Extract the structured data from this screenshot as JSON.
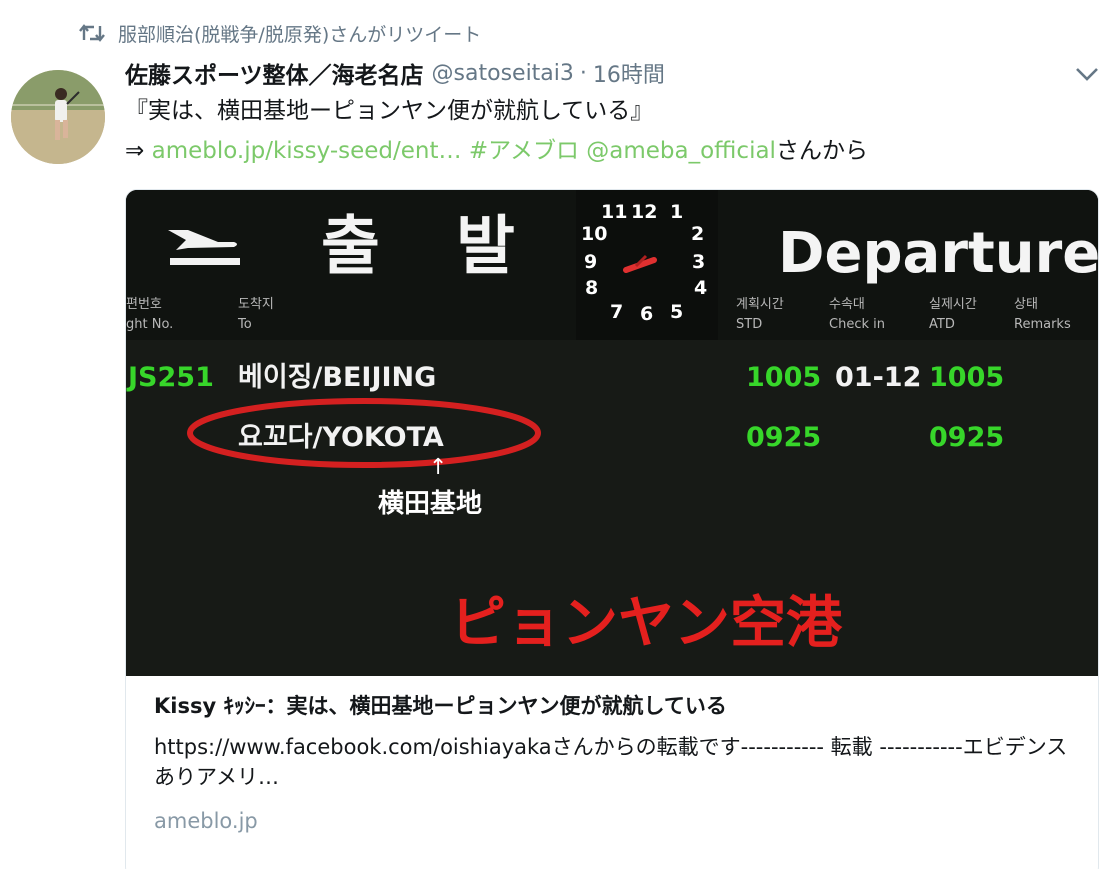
{
  "retweet": {
    "icon": "retweet-icon",
    "text": "服部順治(脱戦争/脱原発)さんがリツイート"
  },
  "tweet": {
    "author_name": "佐藤スポーツ整体／海老名店",
    "handle": "@satoseitai3",
    "separator": "·",
    "time": "16時間",
    "text_line1": "『実は、横田基地ーピョンヤン便が就航している』",
    "arrow": "⇒",
    "link_url": "ameblo.jp/kissy-seed/ent…",
    "hashtag": "#アメブロ",
    "mention": "@ameba_official",
    "suffix": "さんから",
    "link_color": "#7cc96a"
  },
  "card": {
    "image": {
      "hangul_depart": [
        "출",
        "발"
      ],
      "departure": "Departure",
      "clock_numbers": [
        "11",
        "12",
        "1",
        "10",
        "2",
        "9",
        "3",
        "8",
        "4",
        "7",
        "6",
        "5"
      ],
      "column_headers": [
        {
          "kr": "편번호",
          "en": "ght No."
        },
        {
          "kr": "도착지",
          "en": "To"
        },
        {
          "kr": "계획시간",
          "en": "STD"
        },
        {
          "kr": "수속대",
          "en": "Check in"
        },
        {
          "kr": "실제시간",
          "en": "ATD"
        },
        {
          "kr": "상태",
          "en": "Remarks"
        }
      ],
      "rows": [
        {
          "flight": "JS251",
          "dest": "베이징/BEIJING",
          "std": "1005",
          "checkin": "01-12",
          "atd": "1005"
        },
        {
          "flight": "",
          "dest": "요꼬다/YOKOTA",
          "std": "0925",
          "checkin": "",
          "atd": "0925"
        }
      ],
      "annotation_arrow": "↑",
      "annotation": "横田基地",
      "caption": "ピョンヤン空港",
      "board_green": "#37d62a",
      "circle_red": "#d42020",
      "caption_red": "#e4201e"
    },
    "title": "Kissy ｷｯｼｰ：実は、横田基地ーピョンヤン便が就航している",
    "description": "https://www.facebook.com/oishiayakaさんからの転載です----------- 転載 -----------エビデンスありアメリ…",
    "domain": "ameblo.jp"
  }
}
